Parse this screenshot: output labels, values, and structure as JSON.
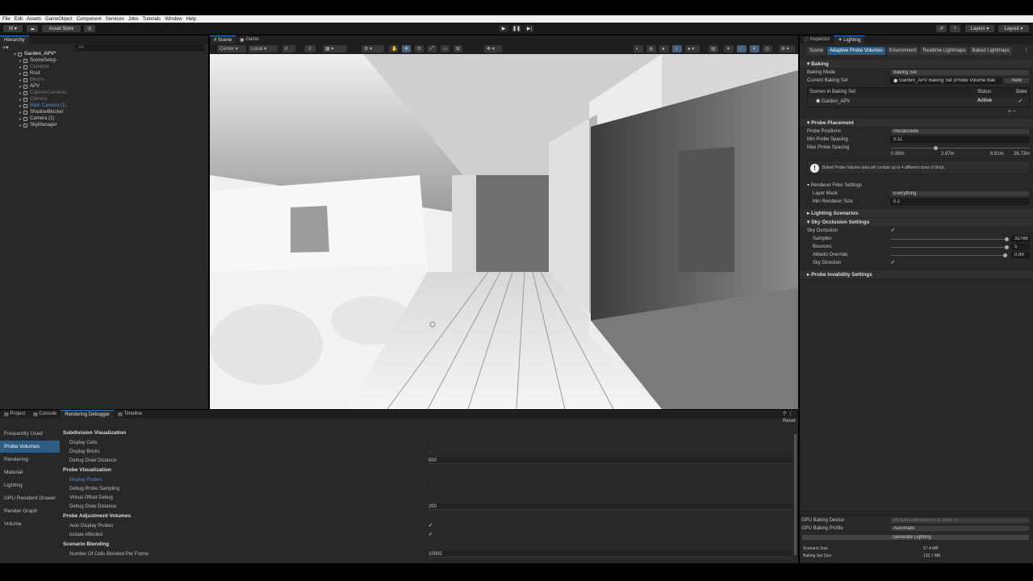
{
  "menubar": [
    "File",
    "Edit",
    "Assets",
    "GameObject",
    "Component",
    "Services",
    "Jobs",
    "Tutorials",
    "Window",
    "Help"
  ],
  "toolbar": {
    "account": "M",
    "asset_store": "Asset Store",
    "layers": "Layers",
    "layout": "Layout"
  },
  "hierarchy": {
    "tab": "Hierarchy",
    "search_placeholder": "All",
    "items": [
      {
        "label": "Garden_APV*",
        "indent": 0,
        "style": "bold"
      },
      {
        "label": "SceneSetup",
        "indent": 1,
        "style": "normal"
      },
      {
        "label": "Cameras",
        "indent": 1,
        "style": "dim"
      },
      {
        "label": "Root",
        "indent": 1,
        "style": "normal"
      },
      {
        "label": "Meshs",
        "indent": 1,
        "style": "dim"
      },
      {
        "label": "APV",
        "indent": 1,
        "style": "normal"
      },
      {
        "label": "CaptureCameras",
        "indent": 1,
        "style": "dim"
      },
      {
        "label": "Camera",
        "indent": 1,
        "style": "dim"
      },
      {
        "label": "Main Camera (1)",
        "indent": 1,
        "style": "blue"
      },
      {
        "label": "ShadowBlocker",
        "indent": 1,
        "style": "normal"
      },
      {
        "label": "Camera (1)",
        "indent": 1,
        "style": "normal"
      },
      {
        "label": "SkyManager",
        "indent": 1,
        "style": "normal"
      }
    ]
  },
  "scene": {
    "tabs": [
      "Scene",
      "Game"
    ],
    "pivot": "Center",
    "space": "Local",
    "snap_value": "0"
  },
  "inspector": {
    "tabs": [
      "Inspector",
      "Lighting"
    ],
    "subtabs": [
      "Scene",
      "Adaptive Probe Volumes",
      "Environment",
      "Realtime Lightmaps",
      "Baked Lightmaps"
    ],
    "baking": {
      "title": "Baking",
      "mode_label": "Baking Mode",
      "mode_value": "Baking Set",
      "set_label": "Current Baking Set",
      "set_value": "Garden_APV Baking Set (Probe Volume Bak",
      "new_button": "New",
      "scenes_header": "Scenes in Baking Set",
      "status_header": "Status",
      "bake_header": "Bake",
      "scene_name": "Garden_APV",
      "scene_status": "Active"
    },
    "placement": {
      "title": "Probe Placement",
      "positions_label": "Probe Positions",
      "positions_value": "Recalculate",
      "min_label": "Min Probe Spacing",
      "min_value": "0.11",
      "max_label": "Max Probe Spacing",
      "ticks": [
        "0.99m",
        "2.97m",
        "8.91m",
        "26.73m"
      ],
      "slider_fraction": 0.32,
      "warning": "Baked Probe Volume data will contain up to 4 different sizes of Brick.",
      "filter_title": "Renderer Filter Settings",
      "layer_label": "Layer Mask",
      "layer_value": "Everything",
      "renderer_label": "Min Renderer Size",
      "renderer_value": "0.1"
    },
    "scenarios_title": "Lighting Scenarios",
    "sky": {
      "title": "Sky Occlusion Settings",
      "occ_label": "Sky Occlusion",
      "samples_label": "Samples",
      "samples_value": "32768",
      "samples_fraction": 1.0,
      "bounces_label": "Bounces",
      "bounces_value": "5",
      "bounces_fraction": 1.0,
      "albedo_label": "Albedo Override",
      "albedo_value": "0.99",
      "albedo_fraction": 0.99,
      "dir_label": "Sky Direction"
    },
    "invalidity_title": "Probe Invalidity Settings",
    "footer": {
      "device_label": "GPU Baking Device",
      "device_value": "NVIDIA GeForce RTX 3080 Ti",
      "profile_label": "GPU Baking Profile",
      "profile_value": "Automatic",
      "generate_label": "Generate Lighting",
      "scenario_size_label": "Scenario Size",
      "scenario_size_value": "57.4 MB",
      "baking_size_label": "Baking Set Size",
      "baking_size_value": "133.7 MB"
    }
  },
  "bottom": {
    "tabs": [
      "Project",
      "Console",
      "Rendering Debugger",
      "Timeline"
    ],
    "reset": "Reset",
    "sidebar": [
      "Frequently Used",
      "Probe Volumes",
      "Rendering",
      "Material",
      "Lighting",
      "GPU Resident Drawer",
      "Render Graph",
      "Volume"
    ],
    "sections": [
      {
        "type": "head",
        "label": "Subdivision Visualization"
      },
      {
        "type": "check",
        "label": "Display Cells",
        "checked": false
      },
      {
        "type": "check",
        "label": "Display Bricks",
        "checked": false
      },
      {
        "type": "value",
        "label": "Debug Draw Distance",
        "value": "500"
      },
      {
        "type": "head",
        "label": "Probe Visualization"
      },
      {
        "type": "check",
        "label": "Display Probes",
        "checked": false,
        "blue": true
      },
      {
        "type": "check",
        "label": "Debug Probe Sampling",
        "checked": false
      },
      {
        "type": "check",
        "label": "Virtual Offset Debug",
        "checked": false
      },
      {
        "type": "value",
        "label": "Debug Draw Distance",
        "value": "200"
      },
      {
        "type": "head",
        "label": "Probe Adjustment Volumes"
      },
      {
        "type": "check",
        "label": "Auto Display Probes",
        "checked": true
      },
      {
        "type": "check",
        "label": "Isolate Affected",
        "checked": true
      },
      {
        "type": "head",
        "label": "Scenario Blending"
      },
      {
        "type": "value",
        "label": "Number Of Cells Blended Per Frame",
        "value": "10000"
      }
    ]
  }
}
